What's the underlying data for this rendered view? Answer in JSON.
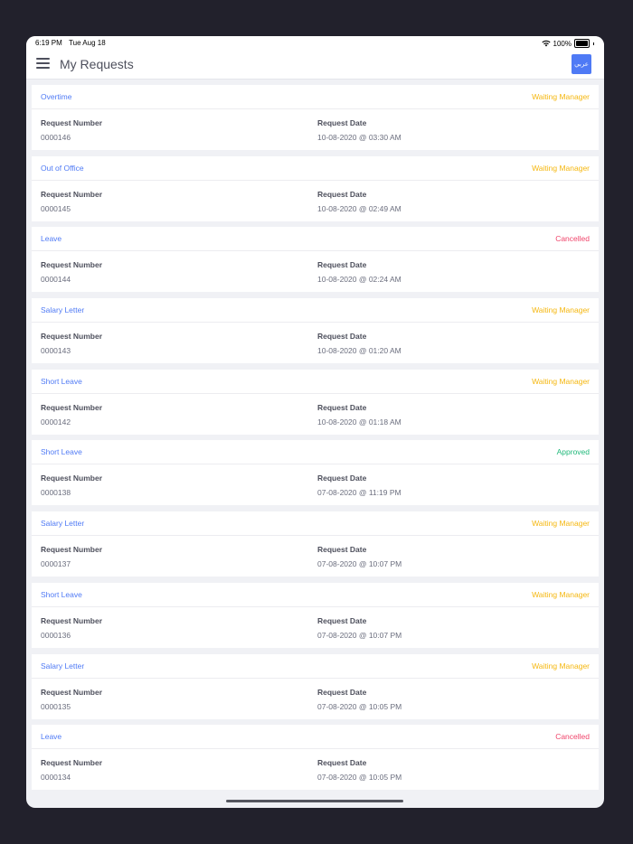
{
  "status_bar": {
    "time": "6:19 PM",
    "date": "Tue Aug 18",
    "battery": "100%",
    "battery_level": 1.0
  },
  "header": {
    "title": "My Requests",
    "language_button": "عربي"
  },
  "labels": {
    "request_number": "Request Number",
    "request_date": "Request Date"
  },
  "colors": {
    "accent": "#4f7af5",
    "waiting": "#f5b70f",
    "cancelled": "#f0456b",
    "approved": "#1fb87a"
  },
  "requests": [
    {
      "type": "Overtime",
      "status": "Waiting Manager",
      "status_kind": "waiting",
      "number": "0000146",
      "date": "10-08-2020 @ 03:30 AM"
    },
    {
      "type": "Out of Office",
      "status": "Waiting Manager",
      "status_kind": "waiting",
      "number": "0000145",
      "date": "10-08-2020 @ 02:49 AM"
    },
    {
      "type": "Leave",
      "status": "Cancelled",
      "status_kind": "cancelled",
      "number": "0000144",
      "date": "10-08-2020 @ 02:24 AM"
    },
    {
      "type": "Salary Letter",
      "status": "Waiting Manager",
      "status_kind": "waiting",
      "number": "0000143",
      "date": "10-08-2020 @ 01:20 AM"
    },
    {
      "type": "Short Leave",
      "status": "Waiting Manager",
      "status_kind": "waiting",
      "number": "0000142",
      "date": "10-08-2020 @ 01:18 AM"
    },
    {
      "type": "Short Leave",
      "status": "Approved",
      "status_kind": "approved",
      "number": "0000138",
      "date": "07-08-2020 @ 11:19 PM"
    },
    {
      "type": "Salary Letter",
      "status": "Waiting Manager",
      "status_kind": "waiting",
      "number": "0000137",
      "date": "07-08-2020 @ 10:07 PM"
    },
    {
      "type": "Short Leave",
      "status": "Waiting Manager",
      "status_kind": "waiting",
      "number": "0000136",
      "date": "07-08-2020 @ 10:07 PM"
    },
    {
      "type": "Salary Letter",
      "status": "Waiting Manager",
      "status_kind": "waiting",
      "number": "0000135",
      "date": "07-08-2020 @ 10:05 PM"
    },
    {
      "type": "Leave",
      "status": "Cancelled",
      "status_kind": "cancelled",
      "number": "0000134",
      "date": "07-08-2020 @ 10:05 PM"
    }
  ]
}
